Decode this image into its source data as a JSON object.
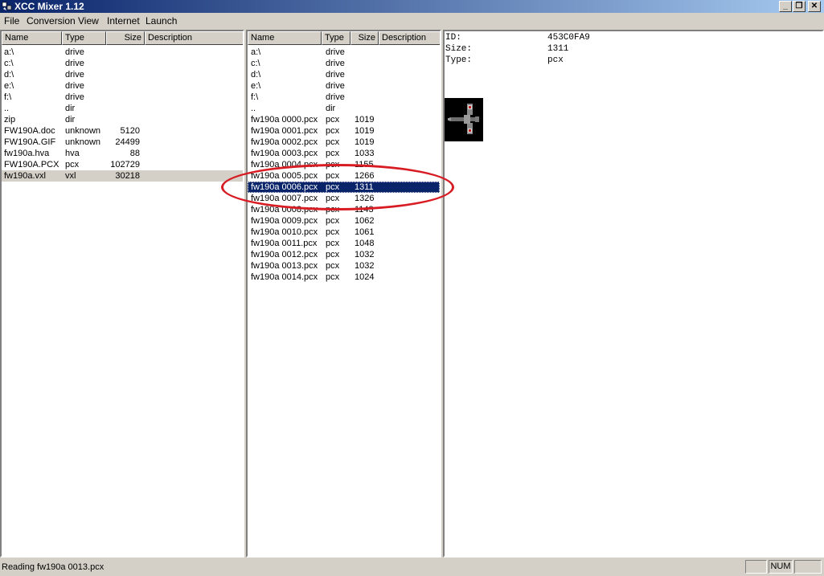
{
  "window": {
    "title": "XCC Mixer 1.12",
    "minimize": "_",
    "maximize": "❐",
    "close": "✕"
  },
  "menu": [
    "File",
    "Conversion",
    "View",
    "Internet",
    "Launch"
  ],
  "columns": {
    "name": "Name",
    "type": "Type",
    "size": "Size",
    "description": "Description"
  },
  "left_panel": {
    "rows": [
      {
        "name": "a:\\",
        "type": "drive",
        "size": ""
      },
      {
        "name": "c:\\",
        "type": "drive",
        "size": ""
      },
      {
        "name": "d:\\",
        "type": "drive",
        "size": ""
      },
      {
        "name": "e:\\",
        "type": "drive",
        "size": ""
      },
      {
        "name": "f:\\",
        "type": "drive",
        "size": ""
      },
      {
        "name": "..",
        "type": "dir",
        "size": ""
      },
      {
        "name": "zip",
        "type": "dir",
        "size": ""
      },
      {
        "name": "FW190A.doc",
        "type": "unknown",
        "size": "5120"
      },
      {
        "name": "FW190A.GIF",
        "type": "unknown",
        "size": "24499"
      },
      {
        "name": "fw190a.hva",
        "type": "hva",
        "size": "88"
      },
      {
        "name": "FW190A.PCX",
        "type": "pcx",
        "size": "102729"
      },
      {
        "name": "fw190a.vxl",
        "type": "vxl",
        "size": "30218"
      }
    ],
    "selected_index": 11
  },
  "middle_panel": {
    "rows": [
      {
        "name": "a:\\",
        "type": "drive",
        "size": ""
      },
      {
        "name": "c:\\",
        "type": "drive",
        "size": ""
      },
      {
        "name": "d:\\",
        "type": "drive",
        "size": ""
      },
      {
        "name": "e:\\",
        "type": "drive",
        "size": ""
      },
      {
        "name": "f:\\",
        "type": "drive",
        "size": ""
      },
      {
        "name": "..",
        "type": "dir",
        "size": ""
      },
      {
        "name": "fw190a 0000.pcx",
        "type": "pcx",
        "size": "1019"
      },
      {
        "name": "fw190a 0001.pcx",
        "type": "pcx",
        "size": "1019"
      },
      {
        "name": "fw190a 0002.pcx",
        "type": "pcx",
        "size": "1019"
      },
      {
        "name": "fw190a 0003.pcx",
        "type": "pcx",
        "size": "1033"
      },
      {
        "name": "fw190a 0004.pcx",
        "type": "pcx",
        "size": "1155"
      },
      {
        "name": "fw190a 0005.pcx",
        "type": "pcx",
        "size": "1266"
      },
      {
        "name": "fw190a 0006.pcx",
        "type": "pcx",
        "size": "1311"
      },
      {
        "name": "fw190a 0007.pcx",
        "type": "pcx",
        "size": "1326"
      },
      {
        "name": "fw190a 0008.pcx",
        "type": "pcx",
        "size": "1143"
      },
      {
        "name": "fw190a 0009.pcx",
        "type": "pcx",
        "size": "1062"
      },
      {
        "name": "fw190a 0010.pcx",
        "type": "pcx",
        "size": "1061"
      },
      {
        "name": "fw190a 0011.pcx",
        "type": "pcx",
        "size": "1048"
      },
      {
        "name": "fw190a 0012.pcx",
        "type": "pcx",
        "size": "1032"
      },
      {
        "name": "fw190a 0013.pcx",
        "type": "pcx",
        "size": "1032"
      },
      {
        "name": "fw190a 0014.pcx",
        "type": "pcx",
        "size": "1024"
      }
    ],
    "selected_index": 12
  },
  "info": {
    "id_label": "ID:",
    "id_value": "453C0FA9",
    "size_label": "Size:",
    "size_value": "1311",
    "type_label": "Type:",
    "type_value": "pcx"
  },
  "status": {
    "text": "Reading fw190a 0013.pcx",
    "num": "NUM"
  },
  "colors": {
    "selection": "#0a246a",
    "annotation": "#d81c24",
    "face": "#d4d0c8"
  },
  "icons": {
    "app": "app-icon"
  }
}
